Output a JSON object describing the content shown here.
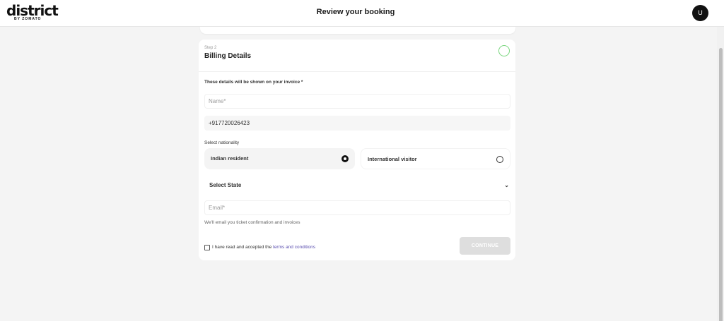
{
  "header": {
    "logo_text": "district",
    "logo_subtext": "BY ZOMATO",
    "title": "Review your booking",
    "avatar_initial": "U"
  },
  "billing": {
    "step_label": "Step 2",
    "title": "Billing Details",
    "invoice_hint": "These details will be shown on your invoice *",
    "name_placeholder": "Name*",
    "phone_value": "+917720026423",
    "nationality_label": "Select nationality",
    "nationality_options": [
      {
        "label": "Indian resident",
        "selected": true
      },
      {
        "label": "International visitor",
        "selected": false
      }
    ],
    "state_select": "Select State",
    "email_placeholder": "Email*",
    "email_note": "We'll email you ticket confirmation and invoices",
    "terms_prefix": "I have read and accepted the ",
    "terms_link": "terms and conditions",
    "terms_checked": false,
    "continue_label": "CONTINUE"
  },
  "colors": {
    "step_circle": "#79d67e",
    "link": "#5b4fb0",
    "button_disabled": "#dedede"
  }
}
